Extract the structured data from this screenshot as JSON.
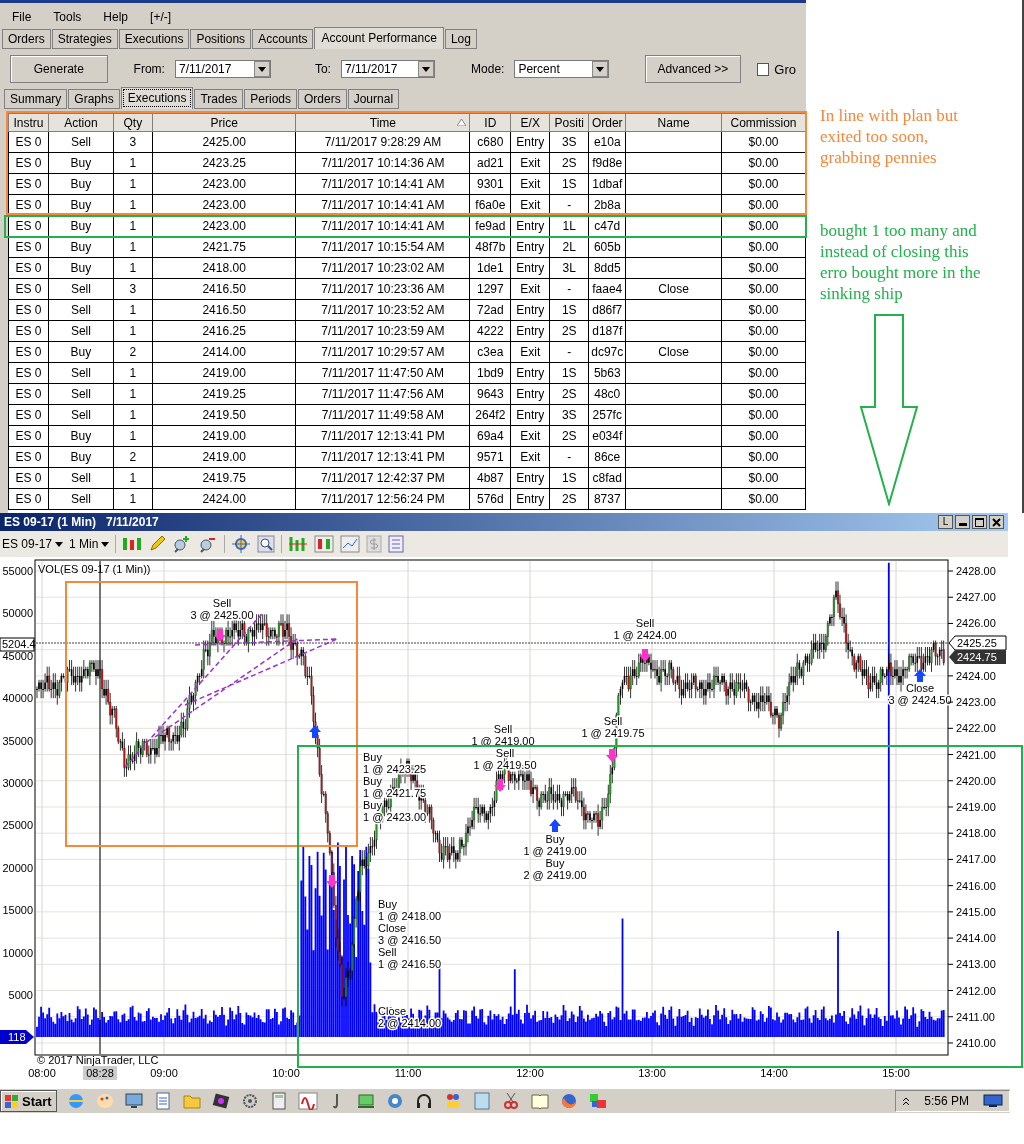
{
  "menu": [
    {
      "label": "File"
    },
    {
      "label": "Tools"
    },
    {
      "label": "Help"
    },
    {
      "label": "[+/-]"
    }
  ],
  "main_tabs": [
    {
      "label": "Orders",
      "selected": false
    },
    {
      "label": "Strategies",
      "selected": false
    },
    {
      "label": "Executions",
      "selected": false
    },
    {
      "label": "Positions",
      "selected": false
    },
    {
      "label": "Accounts",
      "selected": false
    },
    {
      "label": "Account Performance",
      "selected": true
    },
    {
      "label": "Log",
      "selected": false
    }
  ],
  "toolbar": {
    "generate": "Generate",
    "from_label": "From:",
    "from_value": "7/11/2017",
    "to_label": "To:",
    "to_value": "7/11/2017",
    "mode_label": "Mode:",
    "mode_value": "Percent",
    "advanced": "Advanced >>",
    "group_label": "Gro",
    "group_checked": false
  },
  "sub_tabs": [
    {
      "label": "Summary",
      "selected": false
    },
    {
      "label": "Graphs",
      "selected": false
    },
    {
      "label": "Executions",
      "selected": true
    },
    {
      "label": "Trades",
      "selected": false
    },
    {
      "label": "Periods",
      "selected": false
    },
    {
      "label": "Orders",
      "selected": false
    },
    {
      "label": "Journal",
      "selected": false
    }
  ],
  "table": {
    "columns": [
      {
        "label": "Instru",
        "sorted": false
      },
      {
        "label": "Action",
        "sorted": false
      },
      {
        "label": "Qty",
        "sorted": false
      },
      {
        "label": "Price",
        "sorted": false
      },
      {
        "label": "Time",
        "sorted": true
      },
      {
        "label": "ID",
        "sorted": false
      },
      {
        "label": "E/X",
        "sorted": false
      },
      {
        "label": "Positi",
        "sorted": false
      },
      {
        "label": "Order",
        "sorted": false
      },
      {
        "label": "Name",
        "sorted": false
      },
      {
        "label": "Commission",
        "sorted": false
      }
    ],
    "rows": [
      [
        "ES 0",
        "Sell",
        "3",
        "2425.00",
        "7/11/2017 9:28:29 AM",
        "c680",
        "Entry",
        "3S",
        "e10a",
        "",
        "$0.00"
      ],
      [
        "ES 0",
        "Buy",
        "1",
        "2423.25",
        "7/11/2017 10:14:36 AM",
        "ad21",
        "Exit",
        "2S",
        "f9d8e",
        "",
        "$0.00"
      ],
      [
        "ES 0",
        "Buy",
        "1",
        "2423.00",
        "7/11/2017 10:14:41 AM",
        "9301",
        "Exit",
        "1S",
        "1dbaf",
        "",
        "$0.00"
      ],
      [
        "ES 0",
        "Buy",
        "1",
        "2423.00",
        "7/11/2017 10:14:41 AM",
        "f6a0e",
        "Exit",
        "-",
        "2b8a",
        "",
        "$0.00"
      ],
      [
        "ES 0",
        "Buy",
        "1",
        "2423.00",
        "7/11/2017 10:14:41 AM",
        "fe9ad",
        "Entry",
        "1L",
        "c47d",
        "",
        "$0.00"
      ],
      [
        "ES 0",
        "Buy",
        "1",
        "2421.75",
        "7/11/2017 10:15:54 AM",
        "48f7b",
        "Entry",
        "2L",
        "605b",
        "",
        "$0.00"
      ],
      [
        "ES 0",
        "Buy",
        "1",
        "2418.00",
        "7/11/2017 10:23:02 AM",
        "1de1",
        "Entry",
        "3L",
        "8dd5",
        "",
        "$0.00"
      ],
      [
        "ES 0",
        "Sell",
        "3",
        "2416.50",
        "7/11/2017 10:23:36 AM",
        "1297",
        "Exit",
        "-",
        "faae4",
        "Close",
        "$0.00"
      ],
      [
        "ES 0",
        "Sell",
        "1",
        "2416.50",
        "7/11/2017 10:23:52 AM",
        "72ad",
        "Entry",
        "1S",
        "d86f7",
        "",
        "$0.00"
      ],
      [
        "ES 0",
        "Sell",
        "1",
        "2416.25",
        "7/11/2017 10:23:59 AM",
        "4222",
        "Entry",
        "2S",
        "d187f",
        "",
        "$0.00"
      ],
      [
        "ES 0",
        "Buy",
        "2",
        "2414.00",
        "7/11/2017 10:29:57 AM",
        "c3ea",
        "Exit",
        "-",
        "dc97c",
        "Close",
        "$0.00"
      ],
      [
        "ES 0",
        "Sell",
        "1",
        "2419.00",
        "7/11/2017 11:47:50 AM",
        "1bd9",
        "Entry",
        "1S",
        "5b63",
        "",
        "$0.00"
      ],
      [
        "ES 0",
        "Sell",
        "1",
        "2419.25",
        "7/11/2017 11:47:56 AM",
        "9643",
        "Entry",
        "2S",
        "48c0",
        "",
        "$0.00"
      ],
      [
        "ES 0",
        "Sell",
        "1",
        "2419.50",
        "7/11/2017 11:49:58 AM",
        "264f2",
        "Entry",
        "3S",
        "257fc",
        "",
        "$0.00"
      ],
      [
        "ES 0",
        "Buy",
        "1",
        "2419.00",
        "7/11/2017 12:13:41 PM",
        "69a4",
        "Exit",
        "2S",
        "e034f",
        "",
        "$0.00"
      ],
      [
        "ES 0",
        "Buy",
        "2",
        "2419.00",
        "7/11/2017 12:13:41 PM",
        "9571",
        "Exit",
        "-",
        "86ce",
        "",
        "$0.00"
      ],
      [
        "ES 0",
        "Sell",
        "1",
        "2419.75",
        "7/11/2017 12:42:37 PM",
        "4b87",
        "Entry",
        "1S",
        "c8fad",
        "",
        "$0.00"
      ],
      [
        "ES 0",
        "Sell",
        "1",
        "2424.00",
        "7/11/2017 12:56:24 PM",
        "576d",
        "Entry",
        "2S",
        "8737",
        "",
        "$0.00"
      ]
    ]
  },
  "notes": [
    {
      "text": "In line with plan but exited too soon, grabbing pennies",
      "color": "#f7873a"
    },
    {
      "text": "bought 1 too many and instead of closing this erro bought more in the sinking ship",
      "color": "#22b14c"
    }
  ],
  "chart": {
    "title": "ES 09-17 (1 Min)",
    "date": "7/11/2017",
    "maximize_label": "L",
    "instrument": "ES 09-17",
    "interval": "1 Min",
    "indicator_label": "VOL(ES 09-17 (1 Min))",
    "copyright": "© 2017 NinjaTrader, LLC",
    "price_labels": [
      "2428.00",
      "2427.00",
      "2426.00",
      "2424.00",
      "2423.00",
      "2422.00",
      "2421.00",
      "2420.00",
      "2419.00",
      "2418.00",
      "2417.00",
      "2416.00",
      "2415.00",
      "2414.00",
      "2413.00",
      "2412.00",
      "2411.00",
      "2410.00"
    ],
    "volume_labels": [
      "55000",
      "50000",
      "45000",
      "40000",
      "35000",
      "30000",
      "25000",
      "20000",
      "15000",
      "10000",
      "5000"
    ],
    "time_labels": [
      {
        "label": "08:00",
        "highlighted": false
      },
      {
        "label": "08:28",
        "highlighted": true
      },
      {
        "label": "09:00",
        "highlighted": false
      },
      {
        "label": "10:00",
        "highlighted": false
      },
      {
        "label": "11:00",
        "highlighted": false
      },
      {
        "label": "12:00",
        "highlighted": false
      },
      {
        "label": "13:00",
        "highlighted": false
      },
      {
        "label": "14:00",
        "highlighted": false
      },
      {
        "label": "15:00",
        "highlighted": false
      }
    ],
    "last_price": "2425.25",
    "bid_price": "2424.75",
    "crosshair_volume": "5204.4",
    "last_volume": "118",
    "annotations": [
      {
        "kind": "sell",
        "action": "Sell",
        "fill": "3 @ 2425.00"
      },
      {
        "kind": "buy",
        "action": "Buy",
        "fill": "1 @ 2423.25"
      },
      {
        "kind": "buy",
        "action": "Buy",
        "fill": "1 @ 2421.75"
      },
      {
        "kind": "buy",
        "action": "Buy",
        "fill": "1 @ 2423.00"
      },
      {
        "kind": "buy",
        "action": "Buy",
        "fill": "1 @ 2418.00"
      },
      {
        "kind": "sell",
        "action": "Close",
        "fill": "3 @ 2416.50"
      },
      {
        "kind": "sell",
        "action": "Sell",
        "fill": "1 @ 2416.50"
      },
      {
        "kind": "buy",
        "action": "Close",
        "fill": "2 @ 2414.00"
      },
      {
        "kind": "sell",
        "action": "Sell",
        "fill": "1 @ 2419.00"
      },
      {
        "kind": "sell",
        "action": "Sell",
        "fill": "1 @ 2419.50"
      },
      {
        "kind": "buy",
        "action": "Buy",
        "fill": "1 @ 2419.00"
      },
      {
        "kind": "buy",
        "action": "Buy",
        "fill": "2 @ 2419.00"
      },
      {
        "kind": "sell",
        "action": "Sell",
        "fill": "1 @ 2419.75"
      },
      {
        "kind": "sell",
        "action": "Sell",
        "fill": "1 @ 2424.00"
      },
      {
        "kind": "buy",
        "action": "Close",
        "fill": "3 @ 2424.50"
      }
    ]
  },
  "taskbar": {
    "start": "Start",
    "clock": "5:56 PM"
  }
}
